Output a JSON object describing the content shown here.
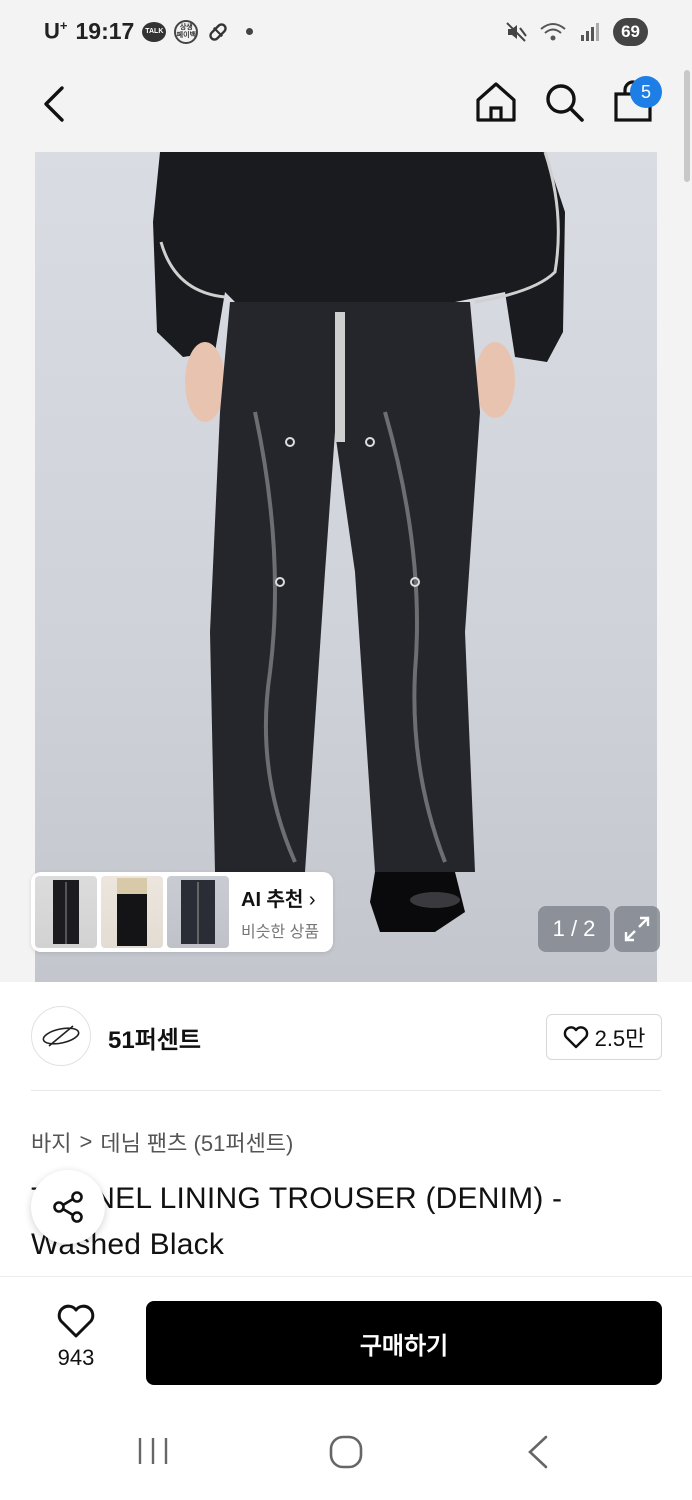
{
  "status": {
    "carrier": "U",
    "carrier_sup": "+",
    "time": "19:17",
    "talk_badge": "TALK",
    "sangsaeng_top": "상생",
    "sangsaeng_bottom": "페이백",
    "battery": "69"
  },
  "header": {
    "cart_count": "5"
  },
  "gallery": {
    "page_indicator": "1 / 2",
    "ai_title": "AI 추천",
    "ai_subtitle": "비슷한 상품"
  },
  "brand": {
    "name": "51퍼센트",
    "likes": "2.5만"
  },
  "product": {
    "breadcrumb_category": "바지",
    "breadcrumb_separator": ">",
    "breadcrumb_sub": "데님 팬츠 (51퍼센트)",
    "title": "TUNNEL LINING TROUSER (DENIM) - Washed Black"
  },
  "bottom": {
    "wish_count": "943",
    "buy_label": "구매하기"
  },
  "icons": {
    "back": "back-arrow-icon",
    "home": "home-icon",
    "search": "search-icon",
    "cart": "shopping-bag-icon",
    "share": "share-icon",
    "heart": "heart-icon",
    "expand": "expand-icon"
  },
  "colors": {
    "cart_badge": "#1d7fe6",
    "buy_button": "#000000",
    "header_bg": "#f3f3f3"
  }
}
